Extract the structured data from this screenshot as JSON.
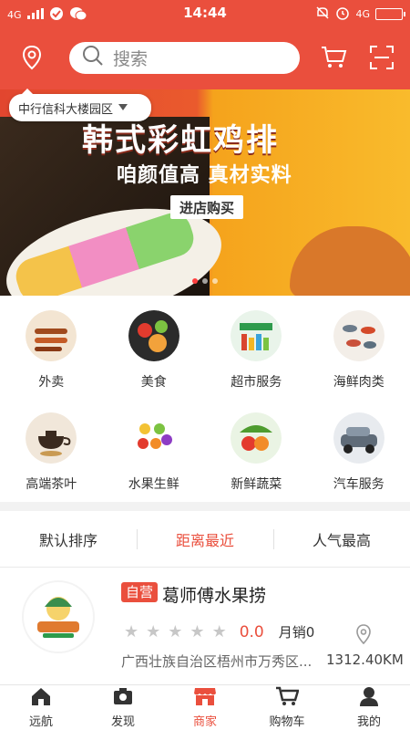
{
  "status": {
    "network": "4G",
    "time": "14:44",
    "network_right": "4G"
  },
  "search": {
    "placeholder": "搜索"
  },
  "location": {
    "label": "中行信科大楼园区"
  },
  "banner": {
    "title": "韩式彩虹鸡排",
    "subtitle": "咱颜值高 真材实料",
    "button": "进店购买"
  },
  "categories": [
    {
      "label": "外卖",
      "icon": "kebab-icon"
    },
    {
      "label": "美食",
      "icon": "food-icon"
    },
    {
      "label": "超市服务",
      "icon": "supermarket-icon"
    },
    {
      "label": "海鲜肉类",
      "icon": "seafood-icon"
    },
    {
      "label": "高端茶叶",
      "icon": "tea-icon"
    },
    {
      "label": "水果生鲜",
      "icon": "fruit-icon"
    },
    {
      "label": "新鲜蔬菜",
      "icon": "vegetable-icon"
    },
    {
      "label": "汽车服务",
      "icon": "car-service-icon"
    }
  ],
  "sort": {
    "default": "默认排序",
    "nearest": "距离最近",
    "popular": "人气最高"
  },
  "store": {
    "badge": "自营",
    "name": "葛师傅水果捞",
    "score": "0.0",
    "monthly_sales": "月销0",
    "address": "广西壮族自治区梧州市万秀区...",
    "distance": "1312.40KM"
  },
  "nav": [
    {
      "label": "远航",
      "icon": "home-icon"
    },
    {
      "label": "发现",
      "icon": "camera-icon"
    },
    {
      "label": "商家",
      "icon": "store-icon"
    },
    {
      "label": "购物车",
      "icon": "cart-icon"
    },
    {
      "label": "我的",
      "icon": "user-icon"
    }
  ],
  "colors": {
    "brand": "#ea4f3d",
    "text": "#333333",
    "muted": "#888888"
  }
}
